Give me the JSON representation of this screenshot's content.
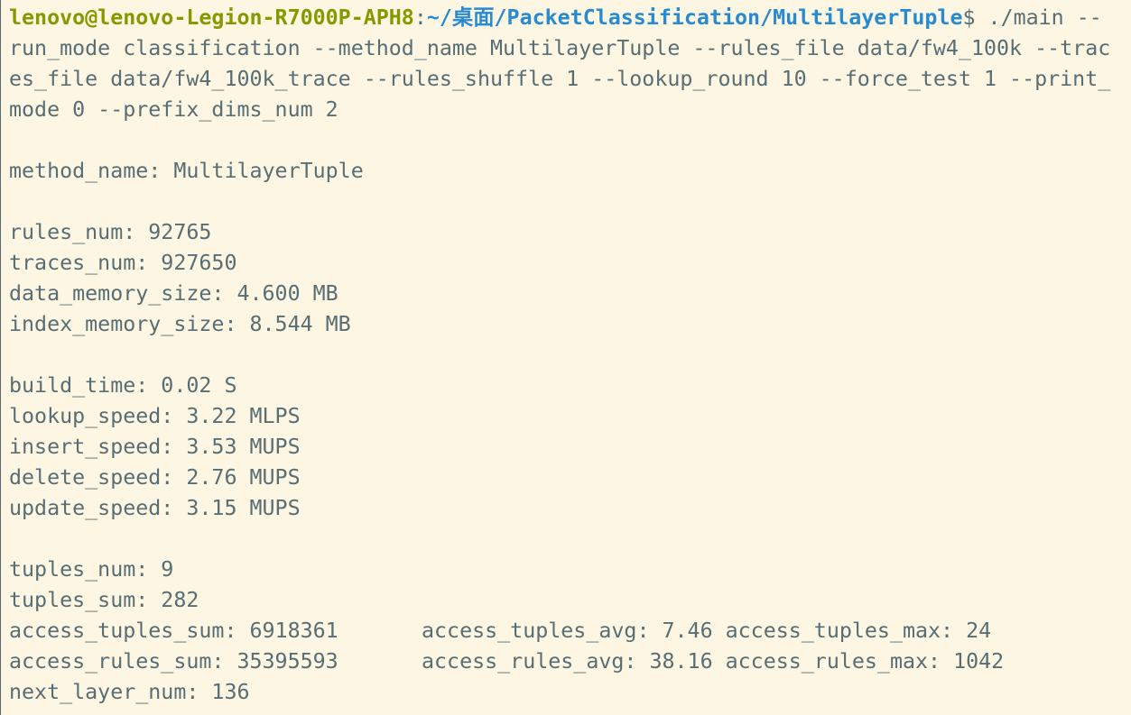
{
  "prompt": {
    "user_host": "lenovo@lenovo-Legion-R7000P-APH8",
    "separator": ":",
    "path": "~/桌面/PacketClassification/MultilayerTuple",
    "dollar": "$"
  },
  "command": {
    "line1": " ./main --",
    "line2": "run_mode classification --method_name MultilayerTuple --rules_file data/fw4_100k --trac",
    "line3": "es_file data/fw4_100k_trace --rules_shuffle 1 --lookup_round 10 --force_test 1 --print_",
    "line4": "mode 0 --prefix_dims_num 2"
  },
  "output": {
    "method_name": "method_name: MultilayerTuple",
    "rules_num": "rules_num: 92765",
    "traces_num": "traces_num: 927650",
    "data_memory_size": "data_memory_size: 4.600 MB",
    "index_memory_size": "index_memory_size: 8.544 MB",
    "build_time": "build_time: 0.02 S",
    "lookup_speed": "lookup_speed: 3.22 MLPS",
    "insert_speed": "insert_speed: 3.53 MUPS",
    "delete_speed": "delete_speed: 2.76 MUPS",
    "update_speed": "update_speed: 3.15 MUPS",
    "tuples_num": "tuples_num: 9",
    "tuples_sum": "tuples_sum: 282",
    "access_tuples_sum": "access_tuples_sum: 6918361",
    "access_tuples_rest": "access_tuples_avg: 7.46 access_tuples_max: 24",
    "access_rules_sum": "access_rules_sum: 35395593",
    "access_rules_rest": "access_rules_avg: 38.16 access_rules_max: 1042",
    "next_layer_num": "next_layer_num: 136"
  },
  "colors": {
    "background": "#fdf6e3",
    "text": "#586e75",
    "user_host": "#859900",
    "path": "#268bd2"
  }
}
